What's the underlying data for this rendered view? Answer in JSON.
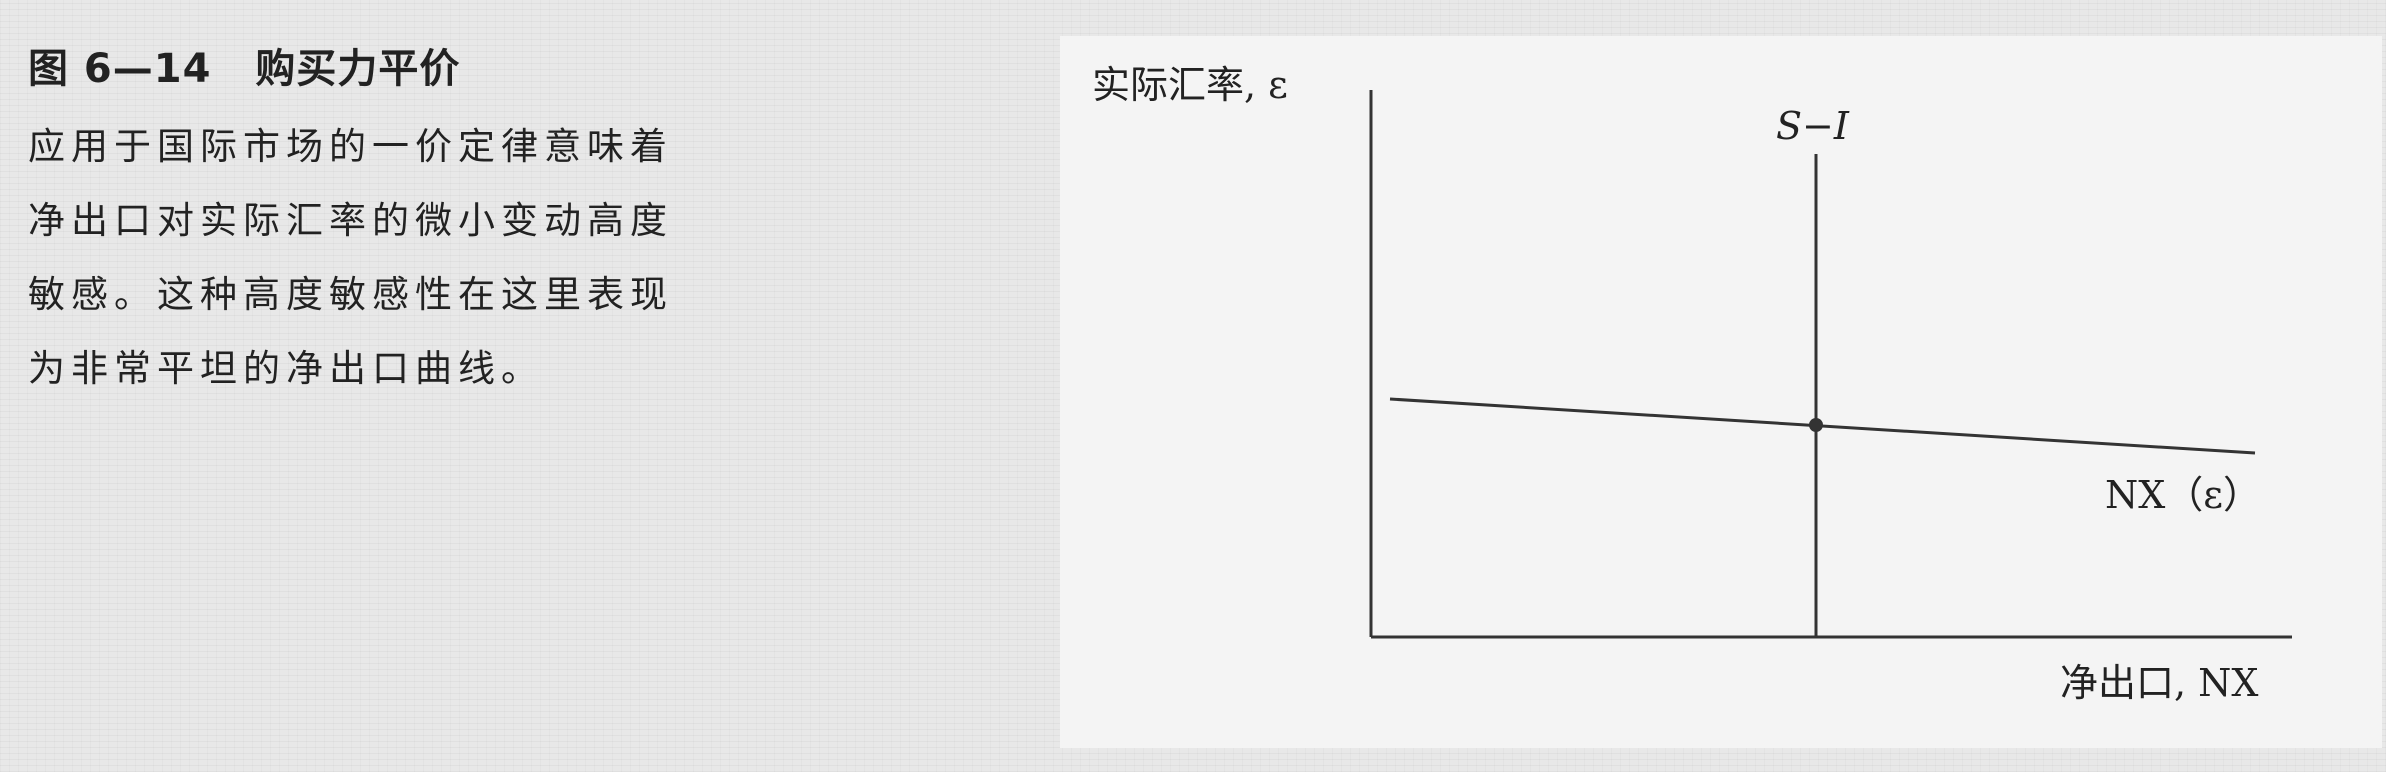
{
  "caption": {
    "figure_number": "图 6—14",
    "figure_title": "购买力平价",
    "lines": [
      "应用于国际市场的一价定律意味着",
      "净出口对实际汇率的微小变动高度",
      "敏感。这种高度敏感性在这里表现",
      "为非常平坦的净出口曲线。"
    ]
  },
  "diagram": {
    "y_axis_label": "实际汇率, ε",
    "x_axis_label": "净出口, NX",
    "vertical_line_label": "S−I",
    "curve_label": "NX（ε）",
    "line_color": "#333333",
    "point_color": "#333333"
  }
}
